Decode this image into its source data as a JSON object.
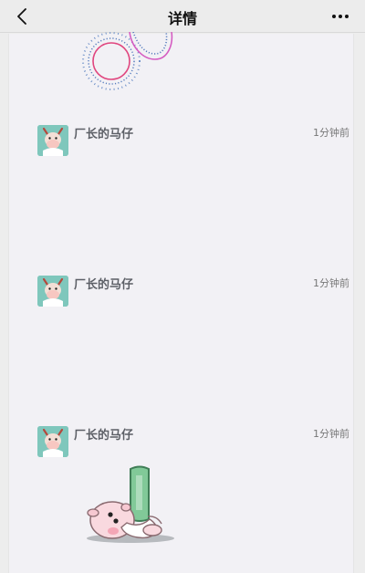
{
  "header": {
    "title": "详情",
    "back_icon": "chevron-left-icon",
    "more_icon": "more-dots-icon"
  },
  "messages": [
    {
      "name": "厂长的马仔",
      "time": "1分钟前"
    },
    {
      "name": "厂长的马仔",
      "time": "1分钟前"
    },
    {
      "name": "厂长的马仔",
      "time": "1分钟前"
    }
  ],
  "colors": {
    "page_bg": "#ededed",
    "content_bg": "#f2f1f5",
    "name_text": "#5c5f66",
    "time_text": "#777777",
    "avatar_bg": "#7fc7bc"
  }
}
